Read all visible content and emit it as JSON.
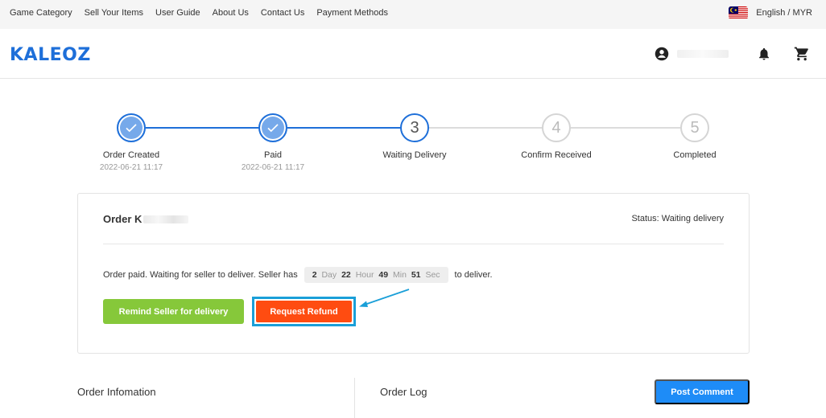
{
  "topbar": {
    "nav": [
      "Game Category",
      "Sell Your Items",
      "User Guide",
      "About Us",
      "Contact Us",
      "Payment Methods"
    ],
    "language": "English / MYR"
  },
  "header": {
    "logo": "KALEOZ"
  },
  "steps": [
    {
      "number": "1",
      "label": "Order Created",
      "time": "2022-06-21 11:17",
      "state": "done"
    },
    {
      "number": "2",
      "label": "Paid",
      "time": "2022-06-21 11:17",
      "state": "done"
    },
    {
      "number": "3",
      "label": "Waiting Delivery",
      "time": "",
      "state": "current"
    },
    {
      "number": "4",
      "label": "Confirm Received",
      "time": "",
      "state": "pending"
    },
    {
      "number": "5",
      "label": "Completed",
      "time": "",
      "state": "pending"
    }
  ],
  "order": {
    "title_prefix": "Order K",
    "status": "Status: Waiting delivery",
    "message_before": "Order paid. Waiting for seller to deliver. Seller has",
    "message_after": "to deliver.",
    "countdown": {
      "days": "2",
      "days_unit": "Day",
      "hours": "22",
      "hours_unit": "Hour",
      "minutes": "49",
      "minutes_unit": "Min",
      "seconds": "51",
      "seconds_unit": "Sec"
    },
    "remind_button": "Remind Seller for delivery",
    "refund_button": "Request Refund"
  },
  "bottom": {
    "order_info": "Order Infomation",
    "order_log": "Order Log",
    "post_comment": "Post Comment"
  },
  "colors": {
    "brand_blue": "#1e6fd9",
    "remind_green": "#86c83a",
    "refund_orange": "#ff4c11",
    "highlight_frame": "#1a9fd8",
    "post_blue": "#1e8cf7"
  }
}
